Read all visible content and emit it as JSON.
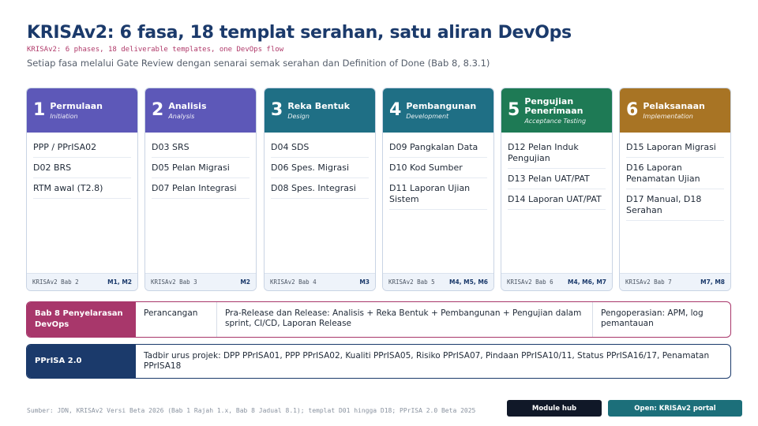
{
  "header": {
    "title": "KRISAv2: 6 fasa, 18 templat serahan, satu aliran DevOps",
    "subtitle_en": "KRISAv2: 6 phases, 18 deliverable templates, one DevOps flow",
    "subtitle": "Setiap fasa melalui Gate Review dengan senarai semak serahan dan Definition of Done (Bab 8, 8.3.1)"
  },
  "phases": [
    {
      "num": "1",
      "name": "Permulaan",
      "en": "Initiation",
      "color": "#5d58b8",
      "items": [
        "PPP / PPrISA02",
        "D02 BRS",
        "RTM awal (T2.8)"
      ],
      "ref": "KRISAv2 Bab 2",
      "milestones": "M1, M2"
    },
    {
      "num": "2",
      "name": "Analisis",
      "en": "Analysis",
      "color": "#5d58b8",
      "items": [
        "D03 SRS",
        "D05 Pelan Migrasi",
        "D07 Pelan Integrasi"
      ],
      "ref": "KRISAv2 Bab 3",
      "milestones": "M2"
    },
    {
      "num": "3",
      "name": "Reka Bentuk",
      "en": "Design",
      "color": "#1f6f85",
      "items": [
        "D04 SDS",
        "D06 Spes. Migrasi",
        "D08 Spes. Integrasi"
      ],
      "ref": "KRISAv2 Bab 4",
      "milestones": "M3"
    },
    {
      "num": "4",
      "name": "Pembangunan",
      "en": "Development",
      "color": "#1f6f85",
      "items": [
        "D09 Pangkalan Data",
        "D10 Kod Sumber",
        "D11 Laporan Ujian Sistem"
      ],
      "ref": "KRISAv2 Bab 5",
      "milestones": "M4, M5, M6"
    },
    {
      "num": "5",
      "name": "Pengujian Penerimaan",
      "en": "Acceptance Testing",
      "color": "#1e7a55",
      "items": [
        "D12 Pelan Induk Pengujian",
        "D13 Pelan UAT/PAT",
        "D14 Laporan UAT/PAT"
      ],
      "ref": "KRISAv2 Bab 6",
      "milestones": "M4, M6, M7"
    },
    {
      "num": "6",
      "name": "Pelaksanaan",
      "en": "Implementation",
      "color": "#a87424",
      "items": [
        "D15 Laporan Migrasi",
        "D16 Laporan Penamatan Ujian",
        "D17 Manual, D18 Serahan"
      ],
      "ref": "KRISAv2 Bab 7",
      "milestones": "M7, M8"
    }
  ],
  "devops": {
    "label": "Bab 8 Penyelarasan DevOps",
    "cells": [
      "Perancangan",
      "Pra-Release dan Release: Analisis + Reka Bentuk + Pembangunan + Pengujian dalam sprint, CI/CD, Laporan Release",
      "Pengoperasian: APM, log pemantauan"
    ]
  },
  "pprisa": {
    "label": "PPrISA 2.0",
    "text": "Tadbir urus projek: DPP PPrISA01, PPP PPrISA02, Kualiti PPrISA05, Risiko PPrISA07, Pindaan PPrISA10/11, Status PPrISA16/17, Penamatan PPrISA18"
  },
  "footer": {
    "source": "Sumber: JDN, KRISAv2 Versi Beta 2026 (Bab 1 Rajah 1.x, Bab 8 Jadual 8.1); templat D01 hingga D18; PPrISA 2.0 Beta 2025",
    "module_hub": "Module hub",
    "open_portal": "Open: KRISAv2 portal"
  }
}
